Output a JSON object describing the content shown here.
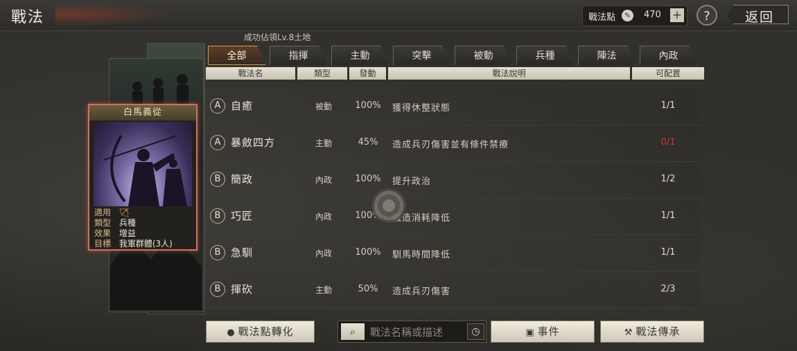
{
  "header": {
    "title": "戰法",
    "points_label": "戰法點",
    "points_value": "470",
    "plus_label": "+",
    "help_label": "?",
    "back_label": "返回"
  },
  "subtitle": "成功佔領Lv.8土地",
  "tabs": [
    {
      "label": "全部",
      "active": true
    },
    {
      "label": "指揮",
      "active": false
    },
    {
      "label": "主動",
      "active": false
    },
    {
      "label": "突擊",
      "active": false
    },
    {
      "label": "被動",
      "active": false
    },
    {
      "label": "兵種",
      "active": false
    },
    {
      "label": "陣法",
      "active": false
    },
    {
      "label": "內政",
      "active": false
    }
  ],
  "columns": {
    "name": "戰法名",
    "type": "類型",
    "rate": "發動",
    "desc": "戰法說明",
    "capacity": "可配置"
  },
  "skills": [
    {
      "grade": "A",
      "name": "自癒",
      "type": "被動",
      "rate": "100%",
      "desc": "獲得休整狀態",
      "capacity": "1/1",
      "warn": false
    },
    {
      "grade": "A",
      "name": "暴斂四方",
      "type": "主動",
      "rate": "45%",
      "desc": "造成兵刃傷害並有條件禁療",
      "capacity": "0/1",
      "warn": true
    },
    {
      "grade": "B",
      "name": "簡政",
      "type": "內政",
      "rate": "100%",
      "desc": "提升政治",
      "capacity": "1/2",
      "warn": false
    },
    {
      "grade": "B",
      "name": "巧匠",
      "type": "內政",
      "rate": "100%",
      "desc": "鍛造消耗降低",
      "capacity": "1/1",
      "warn": false
    },
    {
      "grade": "B",
      "name": "急馴",
      "type": "內政",
      "rate": "100%",
      "desc": "馴馬時間降低",
      "capacity": "1/1",
      "warn": false
    },
    {
      "grade": "B",
      "name": "揮砍",
      "type": "主動",
      "rate": "50%",
      "desc": "造成兵刃傷害",
      "capacity": "2/3",
      "warn": false
    }
  ],
  "card": {
    "title": "白馬義從",
    "info": [
      {
        "key": "適用",
        "value": "🏹"
      },
      {
        "key": "類型",
        "value": "兵種"
      },
      {
        "key": "效果",
        "value": "增益"
      },
      {
        "key": "目標",
        "value": "我軍群體(3人)"
      }
    ]
  },
  "footer": {
    "convert_label": "戰法點轉化",
    "search_placeholder": "戰法名稱或描述",
    "event_label": "事件",
    "inherit_label": "戰法傳承"
  },
  "colors": {
    "accent": "#d39a52",
    "card_border": "#d36f5e",
    "warn": "#d0362c"
  }
}
